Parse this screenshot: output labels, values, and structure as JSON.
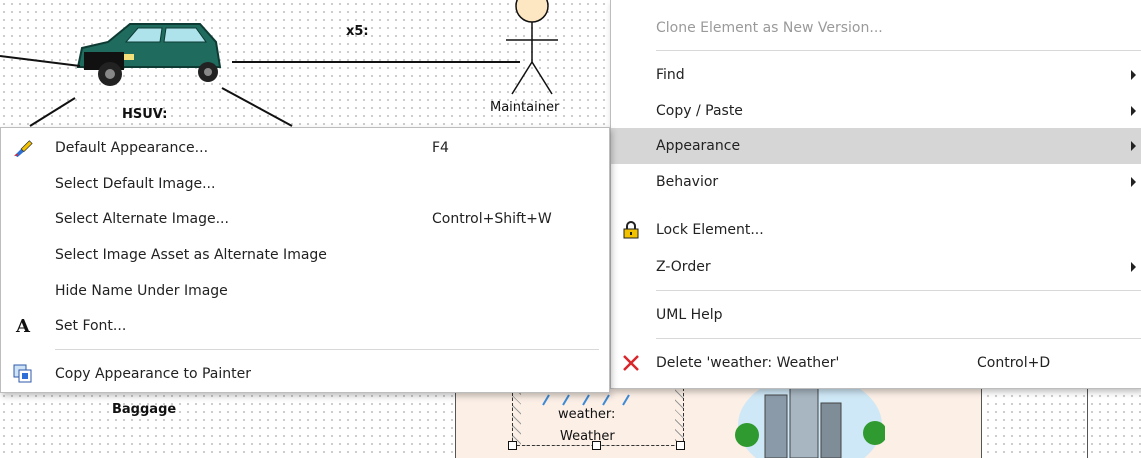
{
  "diagram": {
    "x5_label": "x5:",
    "hsuv_label": "HSUV:",
    "maintainer_label": "Maintainer",
    "baggage_label": "Baggage",
    "weather_label_line1": "weather:",
    "weather_label_line2": "Weather"
  },
  "context_menu": {
    "items": [
      {
        "label": "Clone Element as New Version...",
        "disabled": true
      },
      {
        "label": "Find",
        "submenu": true
      },
      {
        "label": "Copy / Paste",
        "submenu": true
      },
      {
        "label": "Appearance",
        "submenu": true,
        "highlighted": true
      },
      {
        "label": "Behavior",
        "submenu": true
      },
      {
        "label": "Lock Element...",
        "icon": "padlock-icon"
      },
      {
        "label": "Z-Order",
        "submenu": true
      },
      {
        "label": "UML Help"
      },
      {
        "label": "Delete 'weather: Weather'",
        "shortcut": "Control+D",
        "icon": "delete-x-icon"
      }
    ]
  },
  "appearance_submenu": {
    "items": [
      {
        "label": "Default Appearance...",
        "shortcut": "F4",
        "icon": "paint-brush-icon"
      },
      {
        "label": "Select Default Image..."
      },
      {
        "label": "Select Alternate Image...",
        "shortcut": "Control+Shift+W"
      },
      {
        "label": "Select Image Asset as Alternate Image"
      },
      {
        "label": "Hide Name Under Image"
      },
      {
        "label": "Set Font...",
        "icon": "font-icon"
      },
      {
        "label": "Copy Appearance to Painter",
        "icon": "painter-icon"
      }
    ]
  },
  "colors": {
    "highlight": "#d6d6d6",
    "delete_red": "#d9262b",
    "car_body": "#1f6b5e",
    "beige_panel": "#fbefe6"
  }
}
